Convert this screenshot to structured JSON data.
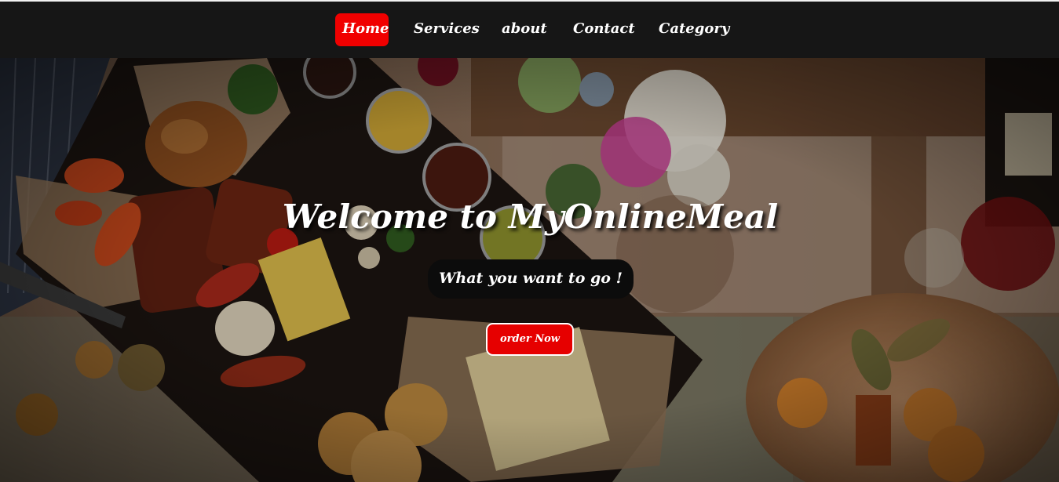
{
  "nav": {
    "items": [
      {
        "label": "Home",
        "active": true
      },
      {
        "label": "Services",
        "active": false
      },
      {
        "label": "about",
        "active": false
      },
      {
        "label": "Contact",
        "active": false
      },
      {
        "label": "Category",
        "active": false
      }
    ]
  },
  "hero": {
    "title": "Welcome to MyOnlineMeal",
    "subtitle": "What you want to go !",
    "cta_label": "order Now"
  },
  "colors": {
    "nav_bg": "#161616",
    "accent": "#f00000",
    "text": "#ffffff",
    "subtitle_bg": "#0c0c0c"
  },
  "icons": [
    "food-background-image"
  ]
}
